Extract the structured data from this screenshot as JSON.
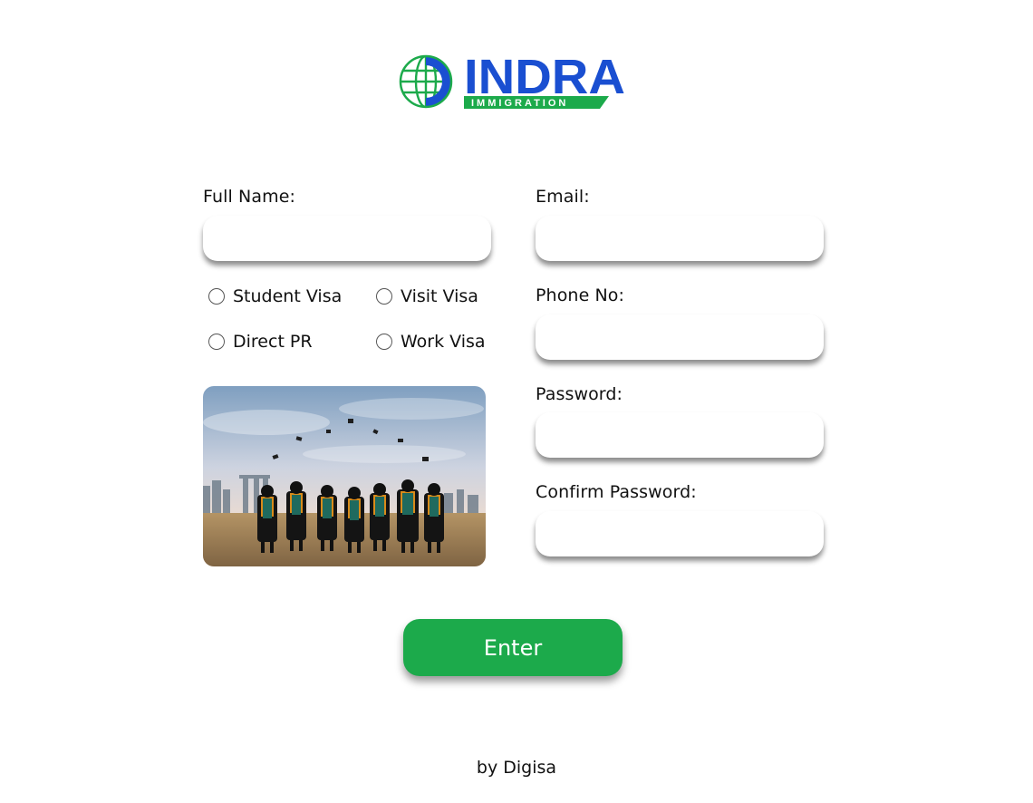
{
  "logo": {
    "brand": "INDRA",
    "tagline": "IMMIGRATION",
    "icon": "globe-logo-icon",
    "colors": {
      "blue": "#1a4fd1",
      "green": "#1caa4b"
    }
  },
  "form": {
    "full_name": {
      "label": "Full Name:",
      "value": "",
      "placeholder": ""
    },
    "email": {
      "label": "Email:",
      "value": "",
      "placeholder": ""
    },
    "phone": {
      "label": "Phone No:",
      "value": "",
      "placeholder": ""
    },
    "password": {
      "label": "Password:",
      "value": "",
      "placeholder": ""
    },
    "confirm_password": {
      "label": "Confirm Password:",
      "value": "",
      "placeholder": ""
    },
    "visa_options": [
      {
        "label": "Student Visa",
        "checked": false
      },
      {
        "label": "Visit Visa",
        "checked": false
      },
      {
        "label": "Direct PR",
        "checked": false
      },
      {
        "label": "Work Visa",
        "checked": false
      }
    ],
    "submit_label": "Enter",
    "submit_color": "#1caa4b"
  },
  "image": {
    "name": "graduates-photo"
  },
  "footer": {
    "credit": "by Digisa"
  }
}
